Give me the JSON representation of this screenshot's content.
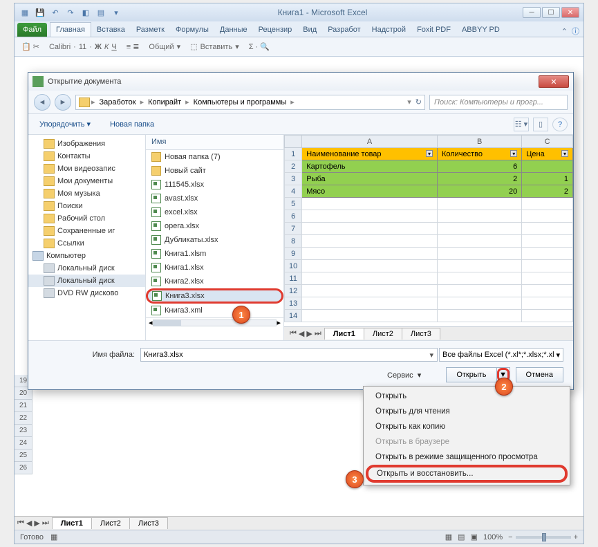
{
  "excel": {
    "title": "Книга1 - Microsoft Excel",
    "tabs": [
      "Файл",
      "Главная",
      "Вставка",
      "Разметк",
      "Формулы",
      "Данные",
      "Рецензир",
      "Вид",
      "Разработ",
      "Надстрой",
      "Foxit PDF",
      "ABBYY PD"
    ],
    "font_sample": "Calibri",
    "font_size": "11",
    "style_label": "Общий",
    "insert_label": "Вставить",
    "row_headers_below": [
      "19",
      "20",
      "21",
      "22",
      "23",
      "24",
      "25",
      "26"
    ],
    "sheets": [
      "Лист1",
      "Лист2",
      "Лист3"
    ],
    "status": "Готово",
    "zoom": "100%"
  },
  "dialog": {
    "title": "Открытие документа",
    "breadcrumb": [
      "Заработок",
      "Копирайт",
      "Компьютеры и программы"
    ],
    "search_placeholder": "Поиск: Компьютеры и прогр...",
    "organize": "Упорядочить",
    "new_folder": "Новая папка",
    "tree": [
      {
        "label": "Изображения",
        "icon": "folder",
        "lvl": 1
      },
      {
        "label": "Контакты",
        "icon": "folder",
        "lvl": 1
      },
      {
        "label": "Мои видеозапис",
        "icon": "folder",
        "lvl": 1
      },
      {
        "label": "Мои документы",
        "icon": "folder",
        "lvl": 1
      },
      {
        "label": "Моя музыка",
        "icon": "folder",
        "lvl": 1
      },
      {
        "label": "Поиски",
        "icon": "folder",
        "lvl": 1
      },
      {
        "label": "Рабочий стол",
        "icon": "folder",
        "lvl": 1
      },
      {
        "label": "Сохраненные иг",
        "icon": "folder",
        "lvl": 1
      },
      {
        "label": "Ссылки",
        "icon": "folder",
        "lvl": 1
      },
      {
        "label": "Компьютер",
        "icon": "comp",
        "lvl": 0
      },
      {
        "label": "Локальный диск",
        "icon": "drive",
        "lvl": 1
      },
      {
        "label": "Локальный диск",
        "icon": "drive",
        "lvl": 1,
        "sel": true
      },
      {
        "label": "DVD RW дисково",
        "icon": "drive",
        "lvl": 1
      }
    ],
    "list_header": "Имя",
    "files": [
      {
        "name": "Новая папка (7)",
        "icon": "folder"
      },
      {
        "name": "Новый сайт",
        "icon": "folder"
      },
      {
        "name": "111545.xlsx",
        "icon": "xl"
      },
      {
        "name": "avast.xlsx",
        "icon": "xl"
      },
      {
        "name": "excel.xlsx",
        "icon": "xl"
      },
      {
        "name": "opera.xlsx",
        "icon": "xl"
      },
      {
        "name": "Дубликаты.xlsx",
        "icon": "xl"
      },
      {
        "name": "Книга1.xlsm",
        "icon": "xl"
      },
      {
        "name": "Книга1.xlsx",
        "icon": "xl"
      },
      {
        "name": "Книга2.xlsx",
        "icon": "xl"
      },
      {
        "name": "Книга3.xlsx",
        "icon": "xl",
        "sel": true
      },
      {
        "name": "Книга3.xml",
        "icon": "xl"
      }
    ],
    "preview": {
      "cols": [
        "",
        "A",
        "B",
        "C"
      ],
      "headers": [
        "Наименование товар",
        "Количество",
        "Цена"
      ],
      "rows": [
        {
          "n": "2",
          "cells": [
            "Картофель",
            "6",
            ""
          ]
        },
        {
          "n": "3",
          "cells": [
            "Рыба",
            "2",
            "1"
          ]
        },
        {
          "n": "4",
          "cells": [
            "Мясо",
            "20",
            "2"
          ]
        }
      ],
      "empty_rows": [
        "5",
        "6",
        "7",
        "8",
        "9",
        "10",
        "11",
        "12",
        "13",
        "14"
      ],
      "sheets": [
        "Лист1",
        "Лист2",
        "Лист3"
      ]
    },
    "filename_label": "Имя файла:",
    "filename_value": "Книга3.xlsx",
    "filter_value": "Все файлы Excel (*.xl*;*.xlsx;*.xl",
    "service_label": "Сервис",
    "open_label": "Открыть",
    "cancel_label": "Отмена"
  },
  "menu": {
    "items": [
      {
        "label": "Открыть"
      },
      {
        "label": "Открыть для чтения"
      },
      {
        "label": "Открыть как копию"
      },
      {
        "label": "Открыть в браузере",
        "disabled": true
      },
      {
        "label": "Открыть в режиме защищенного просмотра"
      },
      {
        "label": "Открыть и восстановить...",
        "highlight": true
      }
    ]
  },
  "badges": {
    "b1": "1",
    "b2": "2",
    "b3": "3"
  }
}
